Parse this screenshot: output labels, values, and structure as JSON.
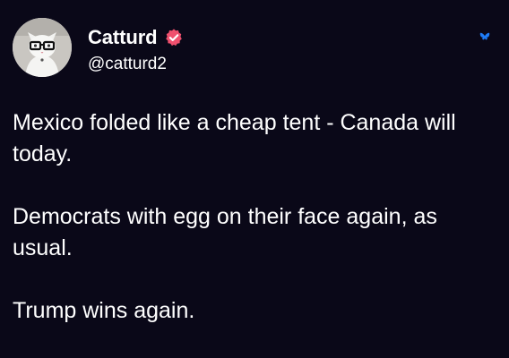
{
  "author": {
    "display_name": "Catturd",
    "handle": "@catturd2",
    "verified_badge_icon": "verified-check-badge-icon",
    "badge_color": "#f0506e"
  },
  "platform_icon": "butterfly-logo-icon",
  "platform_icon_color": "#1e7cf7",
  "post": {
    "paragraphs": [
      "Mexico folded like a cheap tent - Canada will today.",
      "Democrats with egg on their face again, as usual.",
      "Trump wins again."
    ]
  },
  "colors": {
    "background": "#0a0818",
    "text": "#ffffff"
  }
}
